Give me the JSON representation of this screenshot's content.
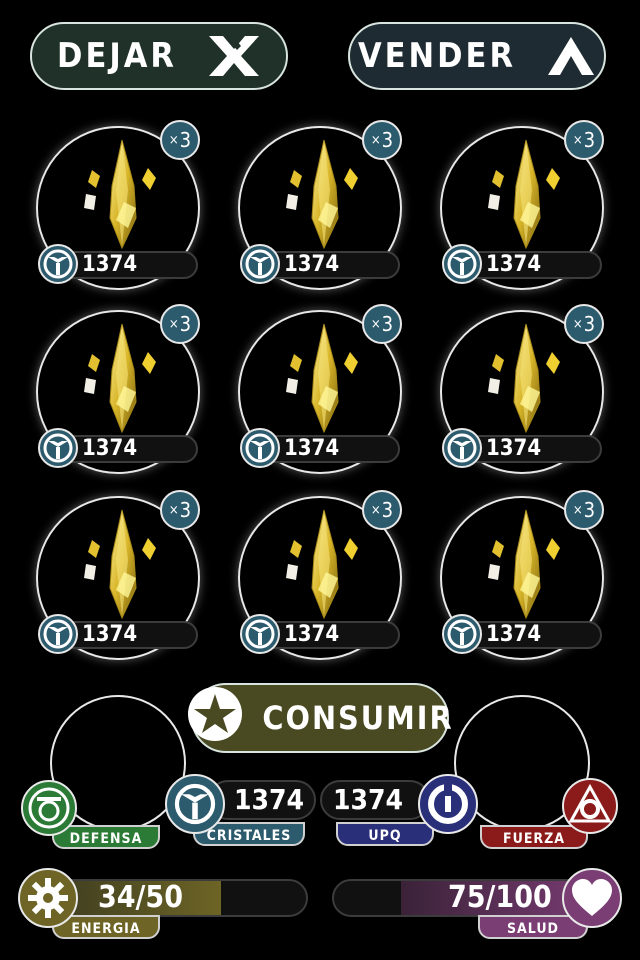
{
  "top": {
    "leave_label": "DEJAR",
    "sell_label": "VENDER"
  },
  "inventory": {
    "slots": [
      {
        "count": "3",
        "value": "1374"
      },
      {
        "count": "3",
        "value": "1374"
      },
      {
        "count": "3",
        "value": "1374"
      },
      {
        "count": "3",
        "value": "1374"
      },
      {
        "count": "3",
        "value": "1374"
      },
      {
        "count": "3",
        "value": "1374"
      },
      {
        "count": "3",
        "value": "1374"
      },
      {
        "count": "3",
        "value": "1374"
      },
      {
        "count": "3",
        "value": "1374"
      }
    ]
  },
  "consume_label": "CONSUMIR",
  "stats": {
    "defense_label": "DEFENSA",
    "crystals_value": "1374",
    "crystals_label": "CRISTALES",
    "upq_value": "1374",
    "upq_label": "UPQ",
    "strength_label": "FUERZA"
  },
  "bars": {
    "energy": {
      "text": "34/50",
      "label": "ENERGIA",
      "fraction": 0.68
    },
    "health": {
      "text": "75/100",
      "label": "SALUD",
      "fraction": 0.75
    }
  },
  "colors": {
    "defense": "#2b7a35",
    "crystals": "#2d5b6e",
    "upq": "#2a2f7a",
    "strength": "#8b1a1a",
    "energy": "#6d6425",
    "health": "#7a3d74"
  },
  "icons": {
    "leave": "x-icon",
    "sell": "chevron-up-icon",
    "consume": "star-icon",
    "defense": "shield-ring-icon",
    "crystals": "crystal-emblem-icon",
    "upq": "lock-ring-icon",
    "strength": "triangle-circle-icon",
    "energy": "gear-icon",
    "health": "heart-icon"
  }
}
